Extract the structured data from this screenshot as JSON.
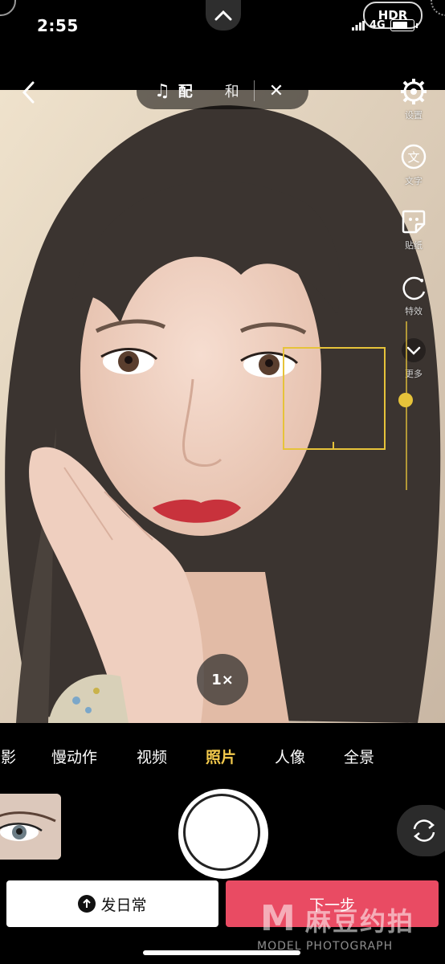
{
  "status_bar": {
    "time": "2:55",
    "hdr": "HDR",
    "network": "4G"
  },
  "music_bar": {
    "label": "配",
    "extra": "和",
    "icon": "music-note-icon"
  },
  "side_tools": [
    {
      "name": "settings",
      "icon": "gear-icon",
      "label": "设置"
    },
    {
      "name": "text",
      "icon": "text-bubble-icon",
      "label": "文字"
    },
    {
      "name": "sticker",
      "icon": "sticker-icon",
      "label": "贴纸"
    },
    {
      "name": "effects",
      "icon": "effects-icon",
      "label": "特效"
    },
    {
      "name": "more",
      "icon": "chevron-down-icon",
      "label": "更多"
    }
  ],
  "zoom": "1×",
  "mode_tabs": [
    {
      "label": "摄影"
    },
    {
      "label": "慢动作"
    },
    {
      "label": "视频"
    },
    {
      "label": "照片",
      "active": true
    },
    {
      "label": "人像"
    },
    {
      "label": "全景"
    }
  ],
  "buttons": {
    "daily": "发日常",
    "next": "下一步"
  },
  "watermark": {
    "mark": "M",
    "cn": "麻豆约拍",
    "en": "MODEL PHOTOGRAPH"
  },
  "colors": {
    "accent_yellow": "#f2c94c",
    "next_red": "#e94b63"
  }
}
